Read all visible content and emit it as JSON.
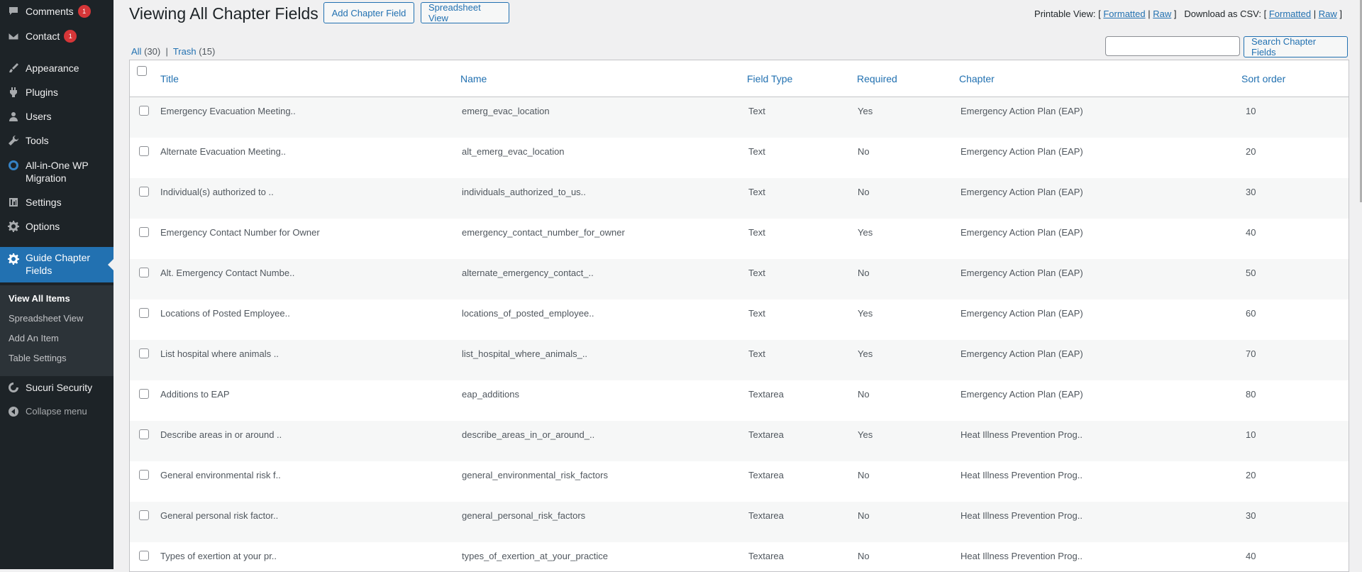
{
  "sidebar": {
    "items": [
      {
        "label": "Comments",
        "icon": "comment-icon",
        "badge": "1"
      },
      {
        "label": "Contact",
        "icon": "mail-icon",
        "badge": "1"
      },
      {
        "label": "Appearance",
        "icon": "paintbrush-icon"
      },
      {
        "label": "Plugins",
        "icon": "plugin-icon"
      },
      {
        "label": "Users",
        "icon": "user-icon"
      },
      {
        "label": "Tools",
        "icon": "wrench-icon"
      },
      {
        "label": "All-in-One WP Migration",
        "icon": "migration-icon"
      },
      {
        "label": "Settings",
        "icon": "settings-icon"
      },
      {
        "label": "Options",
        "icon": "gear-icon"
      },
      {
        "label": "Guide Chapter Fields",
        "icon": "gear-icon"
      },
      {
        "label": "Sucuri Security",
        "icon": "shield-icon"
      }
    ],
    "submenu": [
      "View All Items",
      "Spreadsheet View",
      "Add An Item",
      "Table Settings"
    ],
    "collapse_label": "Collapse menu"
  },
  "header": {
    "title": "Viewing All Chapter Fields",
    "add_button": "Add Chapter Field",
    "spreadsheet_button": "Spreadsheet View",
    "printable_label": "Printable View: [",
    "formatted": "Formatted",
    "sep": "|",
    "raw": "Raw",
    "close": "]",
    "csv_label": "Download as CSV: ["
  },
  "filters": {
    "all": "All",
    "all_count": "(30)",
    "sep": "|",
    "trash": "Trash",
    "trash_count": "(15)"
  },
  "search": {
    "placeholder": "",
    "button": "Search Chapter Fields"
  },
  "table": {
    "columns": [
      "Title",
      "Name",
      "Field Type",
      "Required",
      "Chapter",
      "Sort order"
    ],
    "rows": [
      [
        "Emergency Evacuation Meeting..",
        "emerg_evac_location",
        "Text",
        "Yes",
        "Emergency Action Plan (EAP)",
        "10"
      ],
      [
        "Alternate Evacuation Meeting..",
        "alt_emerg_evac_location",
        "Text",
        "No",
        "Emergency Action Plan (EAP)",
        "20"
      ],
      [
        "Individual(s) authorized to ..",
        "individuals_authorized_to_us..",
        "Text",
        "No",
        "Emergency Action Plan (EAP)",
        "30"
      ],
      [
        "Emergency Contact Number for Owner",
        "emergency_contact_number_for_owner",
        "Text",
        "Yes",
        "Emergency Action Plan (EAP)",
        "40"
      ],
      [
        "Alt. Emergency Contact Numbe..",
        "alternate_emergency_contact_..",
        "Text",
        "No",
        "Emergency Action Plan (EAP)",
        "50"
      ],
      [
        "Locations of Posted Employee..",
        "locations_of_posted_employee..",
        "Text",
        "Yes",
        "Emergency Action Plan (EAP)",
        "60"
      ],
      [
        "List hospital where animals ..",
        "list_hospital_where_animals_..",
        "Text",
        "Yes",
        "Emergency Action Plan (EAP)",
        "70"
      ],
      [
        "Additions to EAP",
        "eap_additions",
        "Textarea",
        "No",
        "Emergency Action Plan (EAP)",
        "80"
      ],
      [
        "Describe areas in or around ..",
        "describe_areas_in_or_around_..",
        "Textarea",
        "Yes",
        "Heat Illness Prevention Prog..",
        "10"
      ],
      [
        "General environmental risk f..",
        "general_environmental_risk_factors",
        "Textarea",
        "No",
        "Heat Illness Prevention Prog..",
        "20"
      ],
      [
        "General personal risk factor..",
        "general_personal_risk_factors",
        "Textarea",
        "No",
        "Heat Illness Prevention Prog..",
        "30"
      ],
      [
        "Types of exertion at your pr..",
        "types_of_exertion_at_your_practice",
        "Textarea",
        "No",
        "Heat Illness Prevention Prog..",
        "40"
      ]
    ]
  }
}
